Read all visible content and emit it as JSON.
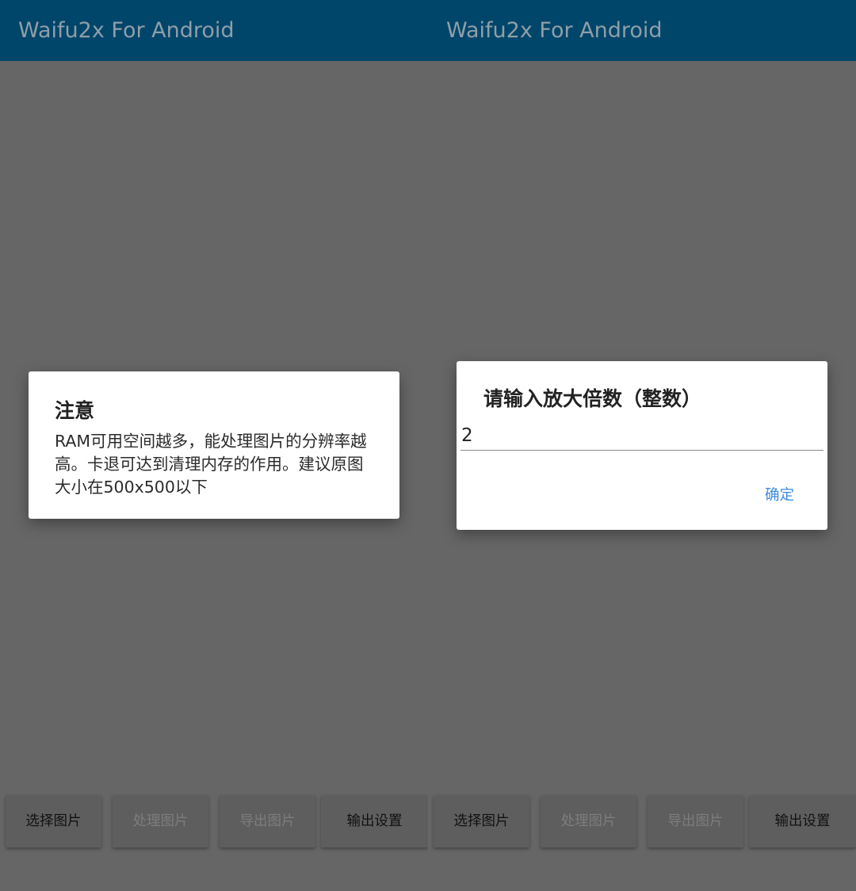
{
  "app_title": "Waifu2x For Android",
  "notice_dialog": {
    "title": "注意",
    "message": "RAM可用空间越多，能处理图片的分辨率越高。卡退可达到清理内存的作用。建议原图大小在500x500以下"
  },
  "input_dialog": {
    "title": "请输入放大倍数（整数）",
    "value": "2",
    "confirm_label": "确定"
  },
  "bottom_buttons": {
    "select_image": "选择图片",
    "process_image": "处理图片",
    "export_image": "导出图片",
    "output_settings": "输出设置"
  },
  "colors": {
    "app_bar": "#00466a",
    "scrim": "#666666",
    "accent": "#3d8bd9"
  }
}
